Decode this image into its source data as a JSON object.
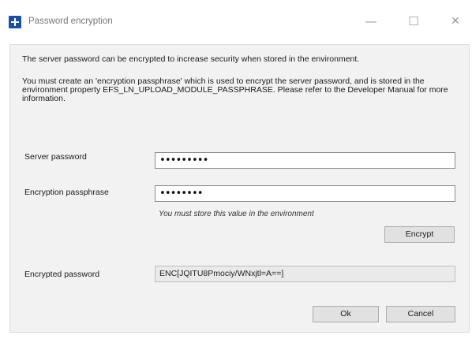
{
  "window": {
    "title": "Password encryption",
    "controls": {
      "minimize": "—",
      "maximize": "☐",
      "close": "✕"
    }
  },
  "intro": {
    "line1": "The server password can be encrypted to increase security when stored in the environment.",
    "line2": "You must create an 'encryption passphrase' which is used to encrypt the server password, and is stored in the environment property EFS_LN_UPLOAD_MODULE_PASSPHRASE. Please refer to the Developer Manual for more information."
  },
  "form": {
    "server_password_label": "Server password",
    "server_password_value": "•••••••••",
    "passphrase_label": "Encryption passphrase",
    "passphrase_value": "••••••••",
    "passphrase_note": "You must store this value in the environment",
    "encrypt_button": "Encrypt",
    "encrypted_label": "Encrypted password",
    "encrypted_value": "ENC[JQITU8Pmociy/WNxjtl=A==]"
  },
  "footer": {
    "ok_button": "Ok",
    "cancel_button": "Cancel"
  }
}
